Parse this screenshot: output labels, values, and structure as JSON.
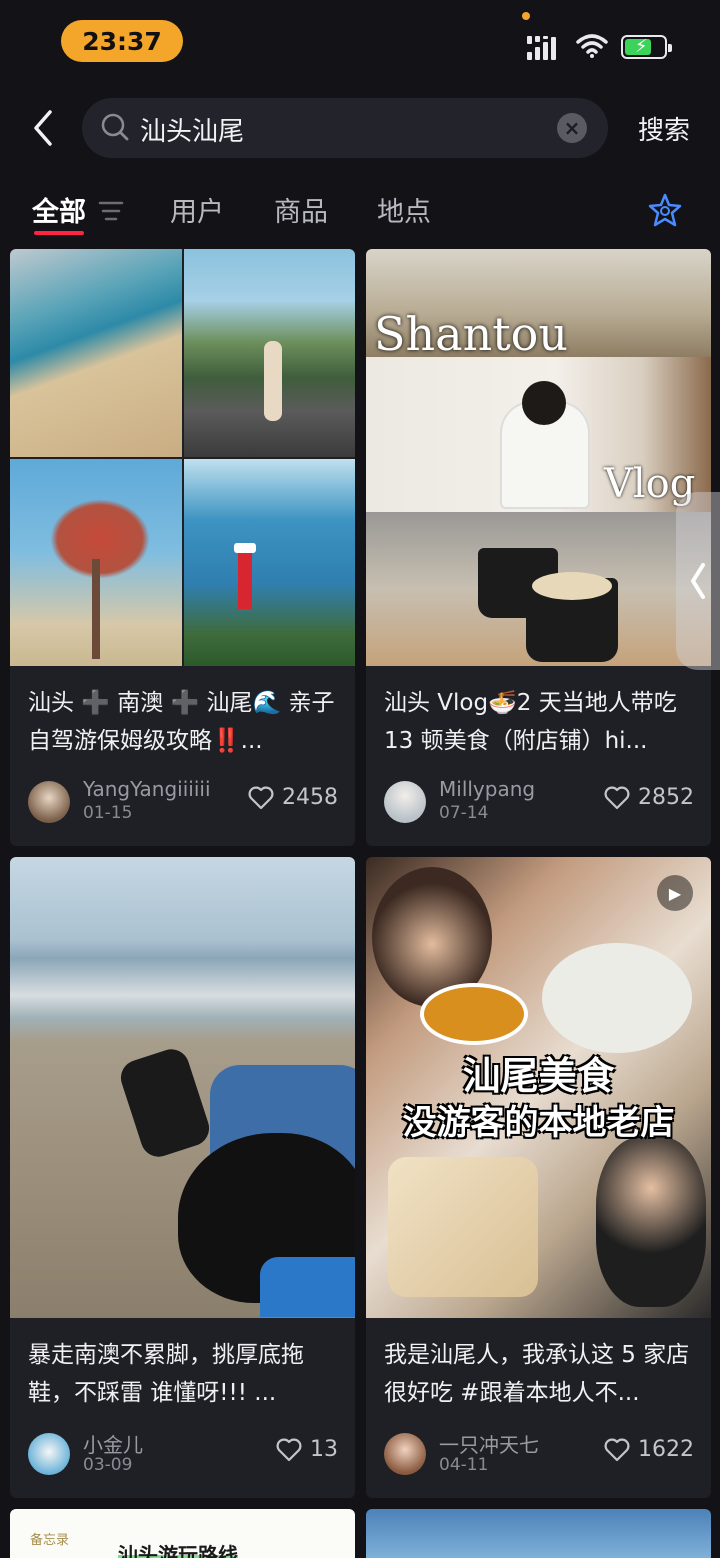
{
  "status_bar": {
    "time": "23:37"
  },
  "search": {
    "query": "汕头汕尾",
    "submit_label": "搜索"
  },
  "tabs": [
    {
      "label": "全部"
    },
    {
      "label": "用户"
    },
    {
      "label": "商品"
    },
    {
      "label": "地点"
    }
  ],
  "colors": {
    "accent": "#ff2442",
    "time_pill": "#f4a62a",
    "ai_icon": "#4a8cff"
  },
  "feed": [
    {
      "title": "汕头 ➕ 南澳 ➕ 汕尾🌊 亲子自驾游保姆级攻略‼️...",
      "author": "YangYangiiiiii",
      "date": "01-15",
      "likes": "2458"
    },
    {
      "title": "汕头 Vlog🍜2 天当地人带吃 13 顿美食（附店铺）hi...",
      "author": "Millypang",
      "date": "07-14",
      "likes": "2852",
      "overlay_text_1": "Shantou",
      "overlay_text_2": "Vlog"
    },
    {
      "title": "暴走南澳不累脚，挑厚底拖鞋，不踩雷 谁懂呀!!! ...",
      "author": "小金儿",
      "date": "03-09",
      "likes": "13"
    },
    {
      "title": "我是汕尾人，我承认这 5 家店很好吃 #跟着本地人不...",
      "author": "一只冲天七",
      "date": "04-11",
      "likes": "1622",
      "caption_1": "汕尾美食",
      "caption_2": "没游客的本地老店"
    }
  ],
  "partial_cards": [
    {
      "label": "备忘录",
      "heading": "汕头游玩路线"
    }
  ]
}
